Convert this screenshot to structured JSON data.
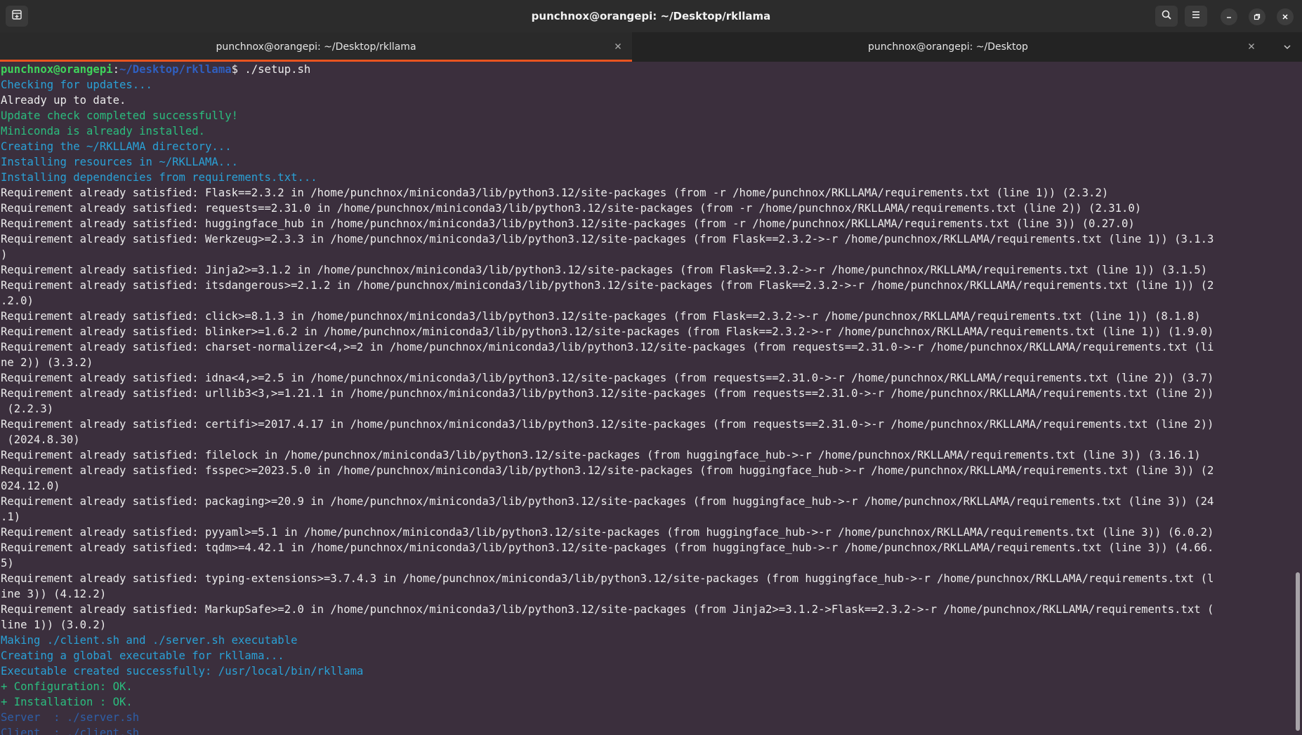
{
  "window": {
    "title": "punchnox@orangepi: ~/Desktop/rkllama"
  },
  "titlebar_icons": {
    "new_tab": "new-tab-icon",
    "search": "search-icon",
    "menu": "hamburger-menu-icon",
    "minimize": "minimize-icon",
    "maximize": "restore-icon",
    "close": "close-icon"
  },
  "tabs": [
    {
      "label": "punchnox@orangepi: ~/Desktop/rkllama",
      "active": true
    },
    {
      "label": "punchnox@orangepi: ~/Desktop",
      "active": false
    }
  ],
  "prompt": {
    "user_host": "punchnox@orangepi",
    "separator": ":",
    "path": "~/Desktop/rkllama",
    "symbol": "$",
    "command": " ./setup.sh"
  },
  "colors": {
    "accent": "#e95420",
    "terminal_bg": "#3b2f3d",
    "blue_text": "#2aa1d6",
    "green_text": "#2bbd7e"
  },
  "lines": [
    {
      "text": "Checking for updates...",
      "color": "blue"
    },
    {
      "text": "Already up to date.",
      "color": "default"
    },
    {
      "text": "Update check completed successfully!",
      "color": "green"
    },
    {
      "text": "Miniconda is already installed.",
      "color": "green"
    },
    {
      "text": "Creating the ~/RKLLAMA directory...",
      "color": "blue"
    },
    {
      "text": "Installing resources in ~/RKLLAMA...",
      "color": "blue"
    },
    {
      "text": "Installing dependencies from requirements.txt...",
      "color": "blue"
    },
    {
      "text": "Requirement already satisfied: Flask==2.3.2 in /home/punchnox/miniconda3/lib/python3.12/site-packages (from -r /home/punchnox/RKLLAMA/requirements.txt (line 1)) (2.3.2)",
      "color": "default"
    },
    {
      "text": "Requirement already satisfied: requests==2.31.0 in /home/punchnox/miniconda3/lib/python3.12/site-packages (from -r /home/punchnox/RKLLAMA/requirements.txt (line 2)) (2.31.0)",
      "color": "default"
    },
    {
      "text": "Requirement already satisfied: huggingface_hub in /home/punchnox/miniconda3/lib/python3.12/site-packages (from -r /home/punchnox/RKLLAMA/requirements.txt (line 3)) (0.27.0)",
      "color": "default"
    },
    {
      "text": "Requirement already satisfied: Werkzeug>=2.3.3 in /home/punchnox/miniconda3/lib/python3.12/site-packages (from Flask==2.3.2->-r /home/punchnox/RKLLAMA/requirements.txt (line 1)) (3.1.3",
      "color": "default"
    },
    {
      "text": ")",
      "color": "default"
    },
    {
      "text": "Requirement already satisfied: Jinja2>=3.1.2 in /home/punchnox/miniconda3/lib/python3.12/site-packages (from Flask==2.3.2->-r /home/punchnox/RKLLAMA/requirements.txt (line 1)) (3.1.5)",
      "color": "default"
    },
    {
      "text": "Requirement already satisfied: itsdangerous>=2.1.2 in /home/punchnox/miniconda3/lib/python3.12/site-packages (from Flask==2.3.2->-r /home/punchnox/RKLLAMA/requirements.txt (line 1)) (2",
      "color": "default"
    },
    {
      "text": ".2.0)",
      "color": "default"
    },
    {
      "text": "Requirement already satisfied: click>=8.1.3 in /home/punchnox/miniconda3/lib/python3.12/site-packages (from Flask==2.3.2->-r /home/punchnox/RKLLAMA/requirements.txt (line 1)) (8.1.8)",
      "color": "default"
    },
    {
      "text": "Requirement already satisfied: blinker>=1.6.2 in /home/punchnox/miniconda3/lib/python3.12/site-packages (from Flask==2.3.2->-r /home/punchnox/RKLLAMA/requirements.txt (line 1)) (1.9.0)",
      "color": "default"
    },
    {
      "text": "Requirement already satisfied: charset-normalizer<4,>=2 in /home/punchnox/miniconda3/lib/python3.12/site-packages (from requests==2.31.0->-r /home/punchnox/RKLLAMA/requirements.txt (li",
      "color": "default"
    },
    {
      "text": "ne 2)) (3.3.2)",
      "color": "default"
    },
    {
      "text": "Requirement already satisfied: idna<4,>=2.5 in /home/punchnox/miniconda3/lib/python3.12/site-packages (from requests==2.31.0->-r /home/punchnox/RKLLAMA/requirements.txt (line 2)) (3.7)",
      "color": "default"
    },
    {
      "text": "Requirement already satisfied: urllib3<3,>=1.21.1 in /home/punchnox/miniconda3/lib/python3.12/site-packages (from requests==2.31.0->-r /home/punchnox/RKLLAMA/requirements.txt (line 2))",
      "color": "default"
    },
    {
      "text": " (2.2.3)",
      "color": "default"
    },
    {
      "text": "Requirement already satisfied: certifi>=2017.4.17 in /home/punchnox/miniconda3/lib/python3.12/site-packages (from requests==2.31.0->-r /home/punchnox/RKLLAMA/requirements.txt (line 2))",
      "color": "default"
    },
    {
      "text": " (2024.8.30)",
      "color": "default"
    },
    {
      "text": "Requirement already satisfied: filelock in /home/punchnox/miniconda3/lib/python3.12/site-packages (from huggingface_hub->-r /home/punchnox/RKLLAMA/requirements.txt (line 3)) (3.16.1)",
      "color": "default"
    },
    {
      "text": "Requirement already satisfied: fsspec>=2023.5.0 in /home/punchnox/miniconda3/lib/python3.12/site-packages (from huggingface_hub->-r /home/punchnox/RKLLAMA/requirements.txt (line 3)) (2",
      "color": "default"
    },
    {
      "text": "024.12.0)",
      "color": "default"
    },
    {
      "text": "Requirement already satisfied: packaging>=20.9 in /home/punchnox/miniconda3/lib/python3.12/site-packages (from huggingface_hub->-r /home/punchnox/RKLLAMA/requirements.txt (line 3)) (24",
      "color": "default"
    },
    {
      "text": ".1)",
      "color": "default"
    },
    {
      "text": "Requirement already satisfied: pyyaml>=5.1 in /home/punchnox/miniconda3/lib/python3.12/site-packages (from huggingface_hub->-r /home/punchnox/RKLLAMA/requirements.txt (line 3)) (6.0.2)",
      "color": "default"
    },
    {
      "text": "Requirement already satisfied: tqdm>=4.42.1 in /home/punchnox/miniconda3/lib/python3.12/site-packages (from huggingface_hub->-r /home/punchnox/RKLLAMA/requirements.txt (line 3)) (4.66.",
      "color": "default"
    },
    {
      "text": "5)",
      "color": "default"
    },
    {
      "text": "Requirement already satisfied: typing-extensions>=3.7.4.3 in /home/punchnox/miniconda3/lib/python3.12/site-packages (from huggingface_hub->-r /home/punchnox/RKLLAMA/requirements.txt (l",
      "color": "default"
    },
    {
      "text": "ine 3)) (4.12.2)",
      "color": "default"
    },
    {
      "text": "Requirement already satisfied: MarkupSafe>=2.0 in /home/punchnox/miniconda3/lib/python3.12/site-packages (from Jinja2>=3.1.2->Flask==2.3.2->-r /home/punchnox/RKLLAMA/requirements.txt (",
      "color": "default"
    },
    {
      "text": "line 1)) (3.0.2)",
      "color": "default"
    },
    {
      "text": "Making ./client.sh and ./server.sh executable",
      "color": "blue"
    },
    {
      "text": "Creating a global executable for rkllama...",
      "color": "blue"
    },
    {
      "text": "Executable created successfully: /usr/local/bin/rkllama",
      "color": "blue"
    },
    {
      "text": "+ Configuration: OK.",
      "color": "green"
    },
    {
      "text": "+ Installation : OK.",
      "color": "green"
    },
    {
      "text": "Server  : ./server.sh",
      "color": "darkblue"
    },
    {
      "text": "Client  : ./client.sh",
      "color": "darkblue"
    }
  ]
}
